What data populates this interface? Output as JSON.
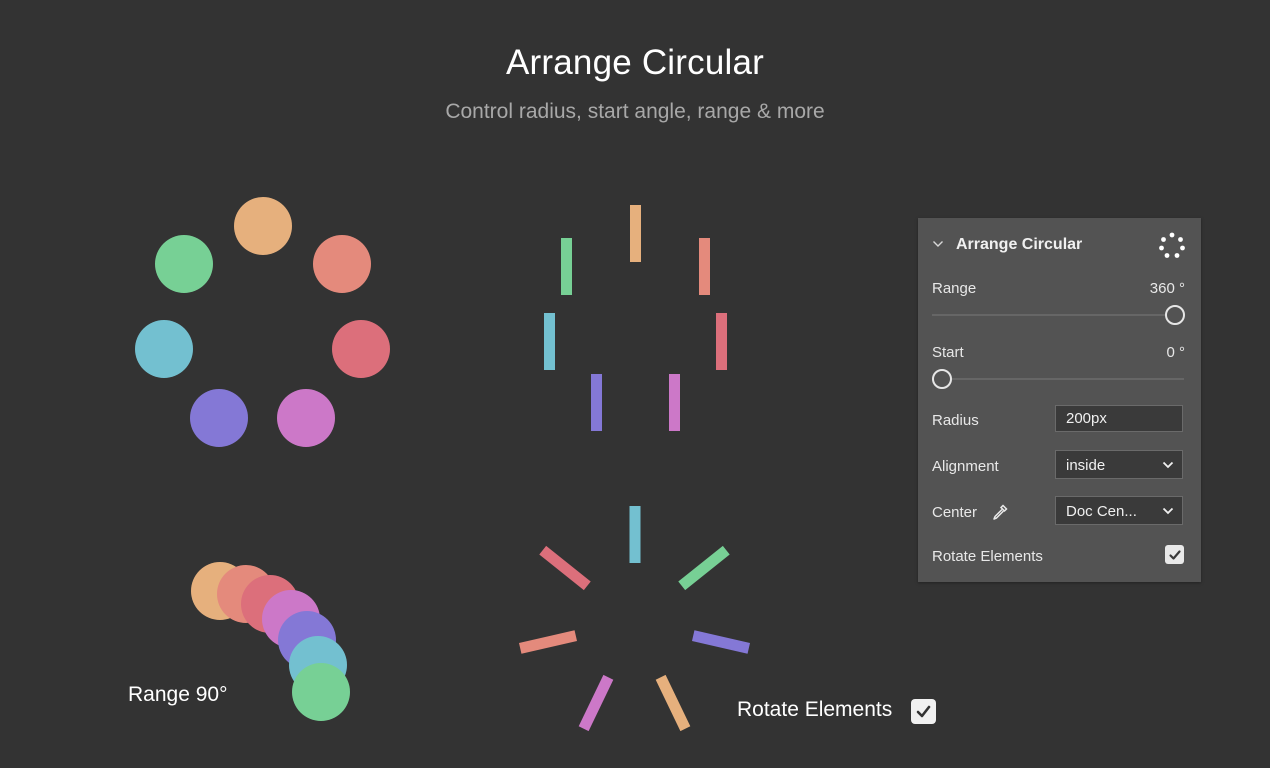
{
  "header": {
    "title": "Arrange Circular",
    "subtitle": "Control radius, start angle, range & more"
  },
  "demos": {
    "range_label": "Range 90°",
    "rotate_label": "Rotate Elements",
    "rotate_checked": true
  },
  "colors": {
    "orange": "#e6b07d",
    "salmon": "#e48a7c",
    "red": "#dc6f7b",
    "pink": "#cc78c8",
    "purple": "#8478d6",
    "cyan": "#73c0d0",
    "green": "#77d095",
    "background": "#333333",
    "panel": "#535353"
  },
  "panel": {
    "title": "Arrange Circular",
    "collapse_icon": "chevron-down-icon",
    "menu_icon": "circle-dots-icon",
    "range": {
      "label": "Range",
      "value": "360 °",
      "fraction": 1.0
    },
    "start": {
      "label": "Start",
      "value": "0 °",
      "fraction": 0.0
    },
    "radius": {
      "label": "Radius",
      "value": "200px"
    },
    "alignment": {
      "label": "Alignment",
      "value": "inside"
    },
    "center": {
      "label": "Center",
      "value": "Doc Cen...",
      "picker_icon": "eyedropper-icon"
    },
    "rotate_elements": {
      "label": "Rotate Elements",
      "checked": true
    }
  }
}
